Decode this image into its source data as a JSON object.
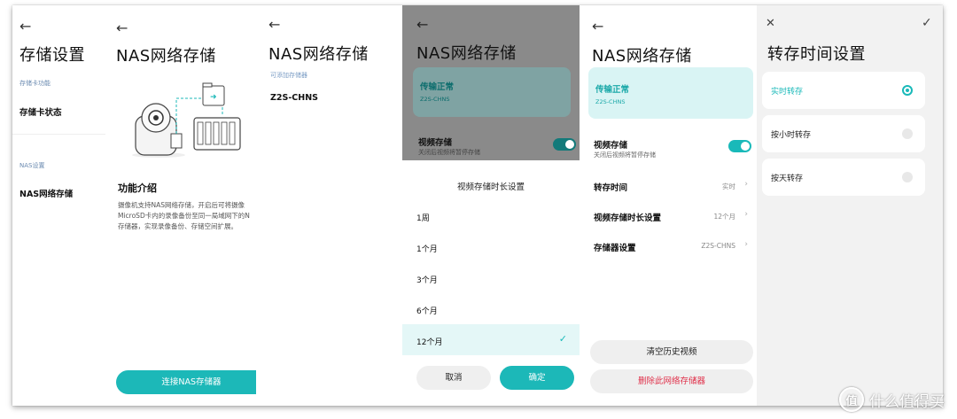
{
  "panel1": {
    "back_icon": "arrow-left-icon",
    "title": "存储设置",
    "section1_caption": "存储卡功能",
    "item1": "存储卡状态",
    "section2_caption": "NAS设置",
    "item2": "NAS网络存储"
  },
  "panel2": {
    "back_icon": "arrow-left-icon",
    "title": "NAS网络存储",
    "intro_title": "功能介绍",
    "intro_line1": "摄像机支持NAS网络存储，开启后可将摄像",
    "intro_line2": "MicroSD卡内的录像备份至同一局域网下的N",
    "intro_line3": "存储器，实现录像备份、存储空间扩展。",
    "connect_button": "连接NAS存储器"
  },
  "panel3": {
    "back_icon": "arrow-left-icon",
    "title": "NAS网络存储",
    "caption": "可添加存储器",
    "device": "Z2S-CHNS"
  },
  "panel4": {
    "back_icon": "arrow-left-icon",
    "title": "NAS网络存储",
    "status": "传输正常",
    "device": "Z2S-CHNS",
    "video_storage_label": "视频存储",
    "video_storage_desc": "关闭后视频将暂停存储",
    "sheet_title": "视频存储时长设置",
    "options": [
      "1周",
      "1个月",
      "3个月",
      "6个月",
      "12个月"
    ],
    "selected_index": 4,
    "cancel": "取消",
    "confirm": "确定"
  },
  "panel5": {
    "back_icon": "arrow-left-icon",
    "title": "NAS网络存储",
    "status": "传输正常",
    "device": "Z2S-CHNS",
    "video_storage_label": "视频存储",
    "video_storage_desc": "关闭后视频将暂停存储",
    "rows": [
      {
        "label": "转存时间",
        "value": "实时"
      },
      {
        "label": "视频存储时长设置",
        "value": "12个月"
      },
      {
        "label": "存储器设置",
        "value": "Z2S-CHNS"
      }
    ],
    "clear_button": "清空历史视频",
    "delete_button": "删除此网络存储器"
  },
  "panel6": {
    "close_icon": "close-icon",
    "check_icon": "check-icon",
    "title": "转存时间设置",
    "options": [
      "实时转存",
      "按小时转存",
      "按天转存"
    ],
    "selected_index": 0
  },
  "watermark": {
    "badge": "值",
    "text": "什么值得买"
  },
  "colors": {
    "accent": "#1cb8b8",
    "status_card": "#d9f4f4",
    "danger": "#e0304a"
  }
}
